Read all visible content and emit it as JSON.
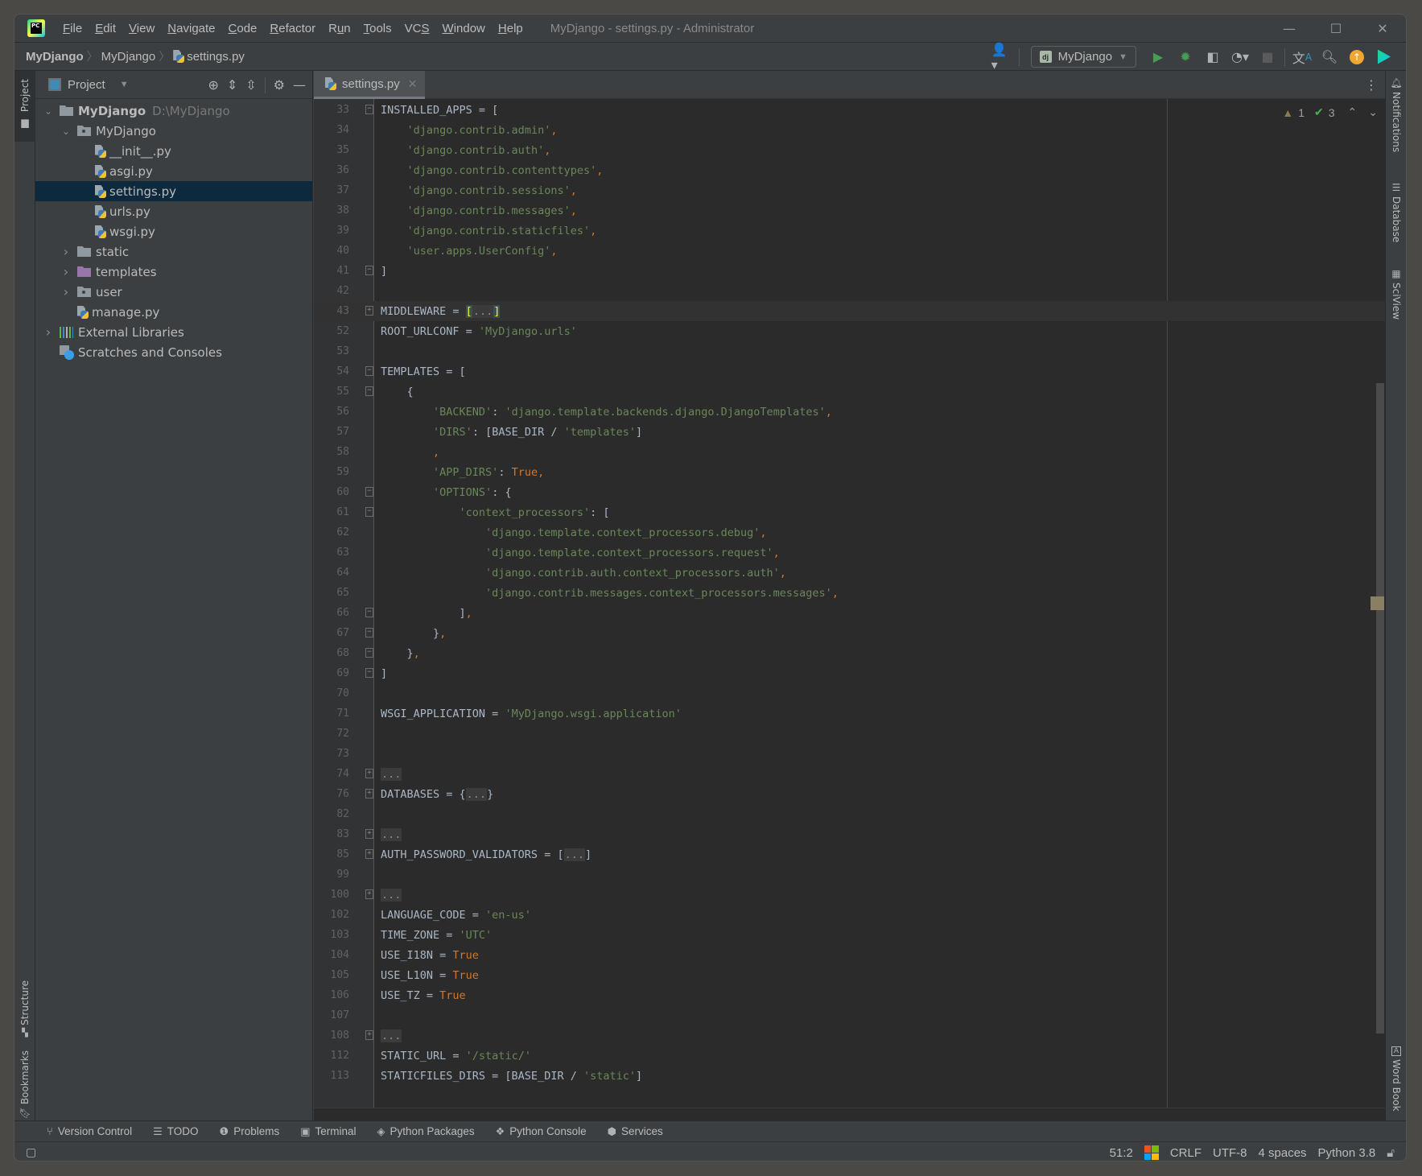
{
  "window": {
    "title": "MyDjango - settings.py - Administrator",
    "controls": {
      "minimize": "—",
      "maximize": "☐",
      "close": "✕"
    }
  },
  "menu": [
    {
      "label": "File",
      "mnemonic": "F",
      "rest": "ile"
    },
    {
      "label": "Edit",
      "mnemonic": "E",
      "rest": "dit"
    },
    {
      "label": "View",
      "mnemonic": "V",
      "rest": "iew"
    },
    {
      "label": "Navigate",
      "mnemonic": "N",
      "rest": "avigate"
    },
    {
      "label": "Code",
      "mnemonic": "C",
      "rest": "ode"
    },
    {
      "label": "Refactor",
      "mnemonic": "R",
      "rest": "efactor"
    },
    {
      "label": "Run",
      "pre": "R",
      "mnemonic": "u",
      "rest": "n"
    },
    {
      "label": "Tools",
      "mnemonic": "T",
      "rest": "ools"
    },
    {
      "label": "VCS",
      "pre": "VC",
      "mnemonic": "S",
      "rest": ""
    },
    {
      "label": "Window",
      "mnemonic": "W",
      "rest": "indow"
    },
    {
      "label": "Help",
      "mnemonic": "H",
      "rest": "elp"
    }
  ],
  "breadcrumb": [
    "MyDjango",
    "MyDjango",
    "settings.py"
  ],
  "run_config": {
    "label": "MyDjango",
    "badge": "dj"
  },
  "project_panel": {
    "title": "Project",
    "tree": [
      {
        "label": "MyDjango",
        "hint": "D:\\MyDjango",
        "depth": 0,
        "expanded": true,
        "type": "root"
      },
      {
        "label": "MyDjango",
        "depth": 1,
        "expanded": true,
        "type": "module"
      },
      {
        "label": "__init__.py",
        "depth": 2,
        "type": "py"
      },
      {
        "label": "asgi.py",
        "depth": 2,
        "type": "py"
      },
      {
        "label": "settings.py",
        "depth": 2,
        "type": "py",
        "selected": true
      },
      {
        "label": "urls.py",
        "depth": 2,
        "type": "py"
      },
      {
        "label": "wsgi.py",
        "depth": 2,
        "type": "py"
      },
      {
        "label": "static",
        "depth": 1,
        "expanded": false,
        "type": "folder"
      },
      {
        "label": "templates",
        "depth": 1,
        "expanded": false,
        "type": "templates"
      },
      {
        "label": "user",
        "depth": 1,
        "expanded": false,
        "type": "module"
      },
      {
        "label": "manage.py",
        "depth": 1,
        "type": "py"
      },
      {
        "label": "External Libraries",
        "depth": 0,
        "expanded": false,
        "type": "libs"
      },
      {
        "label": "Scratches and Consoles",
        "depth": 0,
        "type": "scratch"
      }
    ]
  },
  "editor": {
    "tab": "settings.py",
    "inspections": {
      "warnings": "1",
      "weak_warnings": "3"
    },
    "lines": [
      {
        "n": "33",
        "fold": "open",
        "tokens": [
          [
            "INSTALLED_APPS = [",
            ""
          ]
        ]
      },
      {
        "n": "34",
        "tokens": [
          [
            "    ",
            ""
          ],
          [
            "'django.contrib.admin'",
            "s"
          ],
          [
            ",",
            "k"
          ]
        ]
      },
      {
        "n": "35",
        "tokens": [
          [
            "    ",
            ""
          ],
          [
            "'django.contrib.auth'",
            "s"
          ],
          [
            ",",
            "k"
          ]
        ]
      },
      {
        "n": "36",
        "tokens": [
          [
            "    ",
            ""
          ],
          [
            "'django.contrib.contenttypes'",
            "s"
          ],
          [
            ",",
            "k"
          ]
        ]
      },
      {
        "n": "37",
        "tokens": [
          [
            "    ",
            ""
          ],
          [
            "'django.contrib.sessions'",
            "s"
          ],
          [
            ",",
            "k"
          ]
        ]
      },
      {
        "n": "38",
        "tokens": [
          [
            "    ",
            ""
          ],
          [
            "'django.contrib.messages'",
            "s"
          ],
          [
            ",",
            "k"
          ]
        ]
      },
      {
        "n": "39",
        "tokens": [
          [
            "    ",
            ""
          ],
          [
            "'django.contrib.staticfiles'",
            "s"
          ],
          [
            ",",
            "k"
          ]
        ]
      },
      {
        "n": "40",
        "tokens": [
          [
            "    ",
            ""
          ],
          [
            "'user.apps.UserConfig'",
            "s"
          ],
          [
            ",",
            "k"
          ]
        ]
      },
      {
        "n": "41",
        "fold": "end",
        "tokens": [
          [
            "]",
            ""
          ]
        ]
      },
      {
        "n": "42",
        "tokens": []
      },
      {
        "n": "43",
        "fold": "collapsed",
        "current": true,
        "tokens": [
          [
            "MIDDLEWARE = ",
            ""
          ],
          [
            "[",
            "brace-hl"
          ],
          [
            "...",
            "fold-ph"
          ],
          [
            "]",
            "brace-hl"
          ]
        ]
      },
      {
        "n": "52",
        "tokens": [
          [
            "ROOT_URLCONF = ",
            ""
          ],
          [
            "'MyDjango.urls'",
            "s"
          ]
        ]
      },
      {
        "n": "53",
        "tokens": []
      },
      {
        "n": "54",
        "fold": "open",
        "tokens": [
          [
            "TEMPLATES = [",
            ""
          ]
        ]
      },
      {
        "n": "55",
        "fold": "open",
        "tokens": [
          [
            "    {",
            ""
          ]
        ]
      },
      {
        "n": "56",
        "tokens": [
          [
            "        ",
            ""
          ],
          [
            "'BACKEND'",
            "s"
          ],
          [
            ": ",
            ""
          ],
          [
            "'django.template.backends.django.DjangoTemplates'",
            "s"
          ],
          [
            ",",
            "k"
          ]
        ]
      },
      {
        "n": "57",
        "tokens": [
          [
            "        ",
            ""
          ],
          [
            "'DIRS'",
            "s"
          ],
          [
            ": [BASE_DIR / ",
            ""
          ],
          [
            "'templates'",
            "s"
          ],
          [
            "]",
            ""
          ]
        ]
      },
      {
        "n": "58",
        "tokens": [
          [
            "        ",
            ""
          ],
          [
            ",",
            "k"
          ]
        ]
      },
      {
        "n": "59",
        "tokens": [
          [
            "        ",
            ""
          ],
          [
            "'APP_DIRS'",
            "s"
          ],
          [
            ": ",
            ""
          ],
          [
            "True",
            "k"
          ],
          [
            ",",
            "k"
          ]
        ]
      },
      {
        "n": "60",
        "fold": "open",
        "tokens": [
          [
            "        ",
            ""
          ],
          [
            "'OPTIONS'",
            "s"
          ],
          [
            ": {",
            ""
          ]
        ]
      },
      {
        "n": "61",
        "fold": "open",
        "tokens": [
          [
            "            ",
            ""
          ],
          [
            "'context_processors'",
            "s"
          ],
          [
            ": [",
            ""
          ]
        ]
      },
      {
        "n": "62",
        "tokens": [
          [
            "                ",
            ""
          ],
          [
            "'django.template.context_processors.debug'",
            "s"
          ],
          [
            ",",
            "k"
          ]
        ]
      },
      {
        "n": "63",
        "tokens": [
          [
            "                ",
            ""
          ],
          [
            "'django.template.context_processors.request'",
            "s"
          ],
          [
            ",",
            "k"
          ]
        ]
      },
      {
        "n": "64",
        "tokens": [
          [
            "                ",
            ""
          ],
          [
            "'django.contrib.auth.context_processors.auth'",
            "s"
          ],
          [
            ",",
            "k"
          ]
        ]
      },
      {
        "n": "65",
        "tokens": [
          [
            "                ",
            ""
          ],
          [
            "'django.contrib.messages.context_processors.messages'",
            "s"
          ],
          [
            ",",
            "k"
          ]
        ]
      },
      {
        "n": "66",
        "fold": "end",
        "tokens": [
          [
            "            ]",
            ""
          ],
          [
            ",",
            "k"
          ]
        ]
      },
      {
        "n": "67",
        "fold": "end",
        "tokens": [
          [
            "        }",
            ""
          ],
          [
            ",",
            "k"
          ]
        ]
      },
      {
        "n": "68",
        "fold": "end",
        "tokens": [
          [
            "    }",
            ""
          ],
          [
            ",",
            "k"
          ]
        ]
      },
      {
        "n": "69",
        "fold": "end",
        "tokens": [
          [
            "]",
            ""
          ]
        ]
      },
      {
        "n": "70",
        "tokens": []
      },
      {
        "n": "71",
        "tokens": [
          [
            "WSGI_APPLICATION = ",
            ""
          ],
          [
            "'MyDjango.wsgi.application'",
            "s"
          ]
        ]
      },
      {
        "n": "72",
        "tokens": []
      },
      {
        "n": "73",
        "tokens": []
      },
      {
        "n": "74",
        "fold": "collapsed",
        "tokens": [
          [
            "...",
            "fold-ph"
          ]
        ]
      },
      {
        "n": "76",
        "fold": "collapsed",
        "tokens": [
          [
            "DATABASES = {",
            ""
          ],
          [
            "...",
            "fold-ph"
          ],
          [
            "}",
            ""
          ]
        ]
      },
      {
        "n": "82",
        "tokens": []
      },
      {
        "n": "83",
        "fold": "collapsed",
        "tokens": [
          [
            "...",
            "fold-ph"
          ]
        ]
      },
      {
        "n": "85",
        "fold": "collapsed",
        "tokens": [
          [
            "AUTH_PASSWORD_VALIDATORS = [",
            ""
          ],
          [
            "...",
            "fold-ph"
          ],
          [
            "]",
            ""
          ]
        ]
      },
      {
        "n": "99",
        "tokens": []
      },
      {
        "n": "100",
        "fold": "collapsed",
        "tokens": [
          [
            "...",
            "fold-ph"
          ]
        ]
      },
      {
        "n": "102",
        "tokens": [
          [
            "LANGUAGE_CODE = ",
            ""
          ],
          [
            "'en-us'",
            "s"
          ]
        ]
      },
      {
        "n": "103",
        "tokens": [
          [
            "TIME_ZONE = ",
            ""
          ],
          [
            "'UTC'",
            "s"
          ]
        ]
      },
      {
        "n": "104",
        "tokens": [
          [
            "USE_I18N = ",
            ""
          ],
          [
            "True",
            "k"
          ]
        ]
      },
      {
        "n": "105",
        "tokens": [
          [
            "USE_L10N = ",
            ""
          ],
          [
            "True",
            "k"
          ]
        ]
      },
      {
        "n": "106",
        "tokens": [
          [
            "USE_TZ = ",
            ""
          ],
          [
            "True",
            "k"
          ]
        ]
      },
      {
        "n": "107",
        "tokens": []
      },
      {
        "n": "108",
        "fold": "collapsed",
        "tokens": [
          [
            "...",
            "fold-ph"
          ]
        ]
      },
      {
        "n": "112",
        "tokens": [
          [
            "STATIC_URL = ",
            ""
          ],
          [
            "'/static/'",
            "s"
          ]
        ]
      },
      {
        "n": "113",
        "tokens": [
          [
            "STATICFILES_DIRS = [BASE_DIR / ",
            ""
          ],
          [
            "'static'",
            "s"
          ],
          [
            "]",
            ""
          ]
        ]
      }
    ]
  },
  "left_strip": {
    "top": [
      "Project"
    ],
    "bottom": [
      "Structure",
      "Bookmarks"
    ]
  },
  "right_strip": {
    "top": [
      "Notifications",
      "Database",
      "SciView"
    ],
    "bottom": [
      "Word Book"
    ]
  },
  "bottom_tools": [
    {
      "label": "Version Control",
      "icon": "branch-icon"
    },
    {
      "label": "TODO",
      "icon": "list-icon"
    },
    {
      "label": "Problems",
      "icon": "problems-icon"
    },
    {
      "label": "Terminal",
      "icon": "terminal-icon"
    },
    {
      "label": "Python Packages",
      "icon": "packages-icon"
    },
    {
      "label": "Python Console",
      "icon": "python-console-icon"
    },
    {
      "label": "Services",
      "icon": "services-icon"
    }
  ],
  "status": {
    "position": "51:2",
    "line_sep": "CRLF",
    "encoding": "UTF-8",
    "indent": "4 spaces",
    "interpreter": "Python 3.8"
  },
  "colors": {
    "string": "#6a8759",
    "keyword": "#cc7832",
    "text": "#a9b7c6",
    "selection": "#0d293e",
    "run": "#499c54"
  }
}
